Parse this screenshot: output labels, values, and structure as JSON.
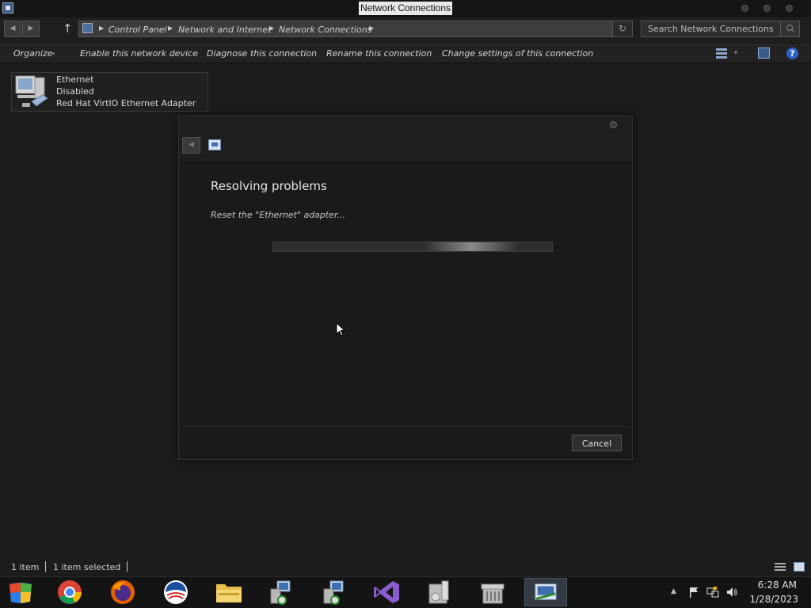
{
  "window": {
    "title": "Network Connections"
  },
  "address_bar": {
    "breadcrumbs": [
      "Control Panel",
      "Network and Internet",
      "Network Connections"
    ],
    "search_placeholder": "Search Network Connections"
  },
  "command_bar": {
    "organize": "Organize",
    "enable_device": "Enable this network device",
    "diagnose": "Diagnose this connection",
    "rename": "Rename this connection",
    "change_settings": "Change settings of this connection"
  },
  "items": [
    {
      "name": "Ethernet",
      "status": "Disabled",
      "device": "Red Hat VirtIO Ethernet Adapter",
      "icon": "network-adapter-icon"
    }
  ],
  "dialog": {
    "heading": "Resolving problems",
    "status": "Reset the \"Ethernet\" adapter...",
    "progress": "indeterminate",
    "cancel_label": "Cancel"
  },
  "status_bar": {
    "item_count": "1 item",
    "selected_count": "1 item selected"
  },
  "taskbar": {
    "apps": [
      "windows-start-icon",
      "chrome-icon",
      "firefox-icon",
      "obama-logo-icon",
      "file-explorer-icon",
      "network-setup-icon",
      "network-setup-icon-2",
      "visual-studio-icon",
      "computer-cd-icon",
      "archive-box-icon",
      "network-connections-icon"
    ],
    "time": "6:28 AM",
    "date": "1/28/2023"
  },
  "colors": {
    "background": "#1c1c1c",
    "dialog": "#1a1a1a",
    "accent_help": "#2a62c8",
    "visual_studio": "#7a4cc0"
  }
}
